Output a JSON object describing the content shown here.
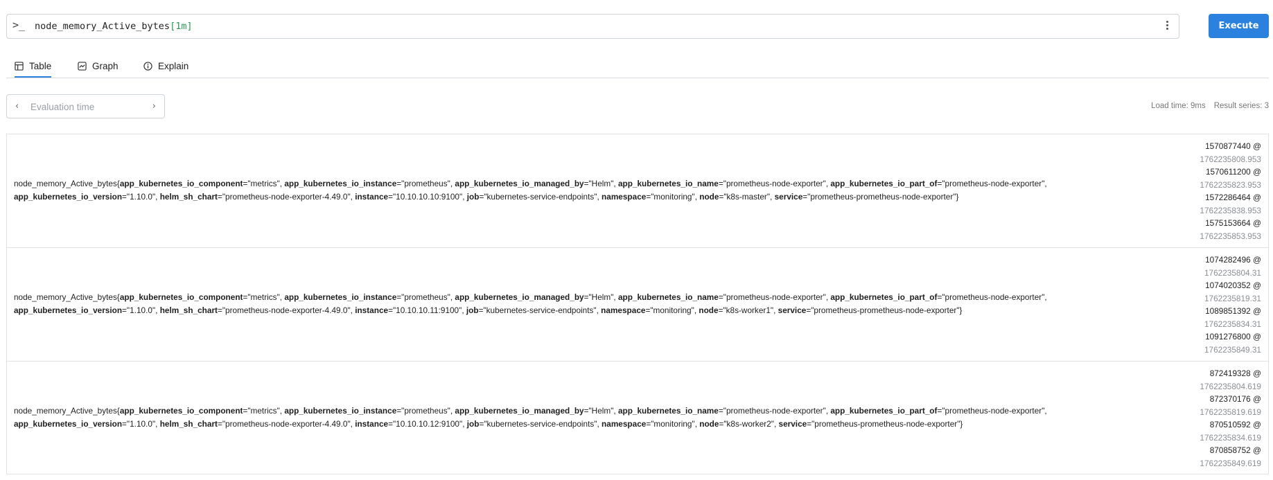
{
  "query": {
    "prompt_icon": "terminal-prompt-icon",
    "prompt_glyph": ">_",
    "expr": "node_memory_Active_bytes",
    "range": "[1m]",
    "menu_icon": "kebab-menu-icon"
  },
  "execute_label": "Execute",
  "tabs": [
    {
      "label": "Table",
      "icon": "table-icon",
      "active": true
    },
    {
      "label": "Graph",
      "icon": "graph-icon",
      "active": false
    },
    {
      "label": "Explain",
      "icon": "info-icon",
      "active": false
    }
  ],
  "eval_time": {
    "placeholder": "Evaluation time",
    "prev_glyph": "‹",
    "next_glyph": "›"
  },
  "stats": {
    "load_time": "Load time: 9ms",
    "result_series": "Result series: 3"
  },
  "results": [
    {
      "metric": "node_memory_Active_bytes",
      "labels": [
        {
          "k": "app_kubernetes_io_component",
          "v": "metrics"
        },
        {
          "k": "app_kubernetes_io_instance",
          "v": "prometheus"
        },
        {
          "k": "app_kubernetes_io_managed_by",
          "v": "Helm"
        },
        {
          "k": "app_kubernetes_io_name",
          "v": "prometheus-node-exporter"
        },
        {
          "k": "app_kubernetes_io_part_of",
          "v": "prometheus-node-exporter"
        },
        {
          "k": "app_kubernetes_io_version",
          "v": "1.10.0"
        },
        {
          "k": "helm_sh_chart",
          "v": "prometheus-node-exporter-4.49.0"
        },
        {
          "k": "instance",
          "v": "10.10.10.10:9100"
        },
        {
          "k": "job",
          "v": "kubernetes-service-endpoints"
        },
        {
          "k": "namespace",
          "v": "monitoring"
        },
        {
          "k": "node",
          "v": "k8s-master"
        },
        {
          "k": "service",
          "v": "prometheus-prometheus-node-exporter"
        }
      ],
      "samples": [
        {
          "value": "1570877440 @",
          "ts": "1762235808.953"
        },
        {
          "value": "1570611200 @",
          "ts": "1762235823.953"
        },
        {
          "value": "1572286464 @",
          "ts": "1762235838.953"
        },
        {
          "value": "1575153664 @",
          "ts": "1762235853.953"
        }
      ]
    },
    {
      "metric": "node_memory_Active_bytes",
      "labels": [
        {
          "k": "app_kubernetes_io_component",
          "v": "metrics"
        },
        {
          "k": "app_kubernetes_io_instance",
          "v": "prometheus"
        },
        {
          "k": "app_kubernetes_io_managed_by",
          "v": "Helm"
        },
        {
          "k": "app_kubernetes_io_name",
          "v": "prometheus-node-exporter"
        },
        {
          "k": "app_kubernetes_io_part_of",
          "v": "prometheus-node-exporter"
        },
        {
          "k": "app_kubernetes_io_version",
          "v": "1.10.0"
        },
        {
          "k": "helm_sh_chart",
          "v": "prometheus-node-exporter-4.49.0"
        },
        {
          "k": "instance",
          "v": "10.10.10.11:9100"
        },
        {
          "k": "job",
          "v": "kubernetes-service-endpoints"
        },
        {
          "k": "namespace",
          "v": "monitoring"
        },
        {
          "k": "node",
          "v": "k8s-worker1"
        },
        {
          "k": "service",
          "v": "prometheus-prometheus-node-exporter"
        }
      ],
      "samples": [
        {
          "value": "1074282496 @",
          "ts": "1762235804.31"
        },
        {
          "value": "1074020352 @",
          "ts": "1762235819.31"
        },
        {
          "value": "1089851392 @",
          "ts": "1762235834.31"
        },
        {
          "value": "1091276800 @",
          "ts": "1762235849.31"
        }
      ]
    },
    {
      "metric": "node_memory_Active_bytes",
      "labels": [
        {
          "k": "app_kubernetes_io_component",
          "v": "metrics"
        },
        {
          "k": "app_kubernetes_io_instance",
          "v": "prometheus"
        },
        {
          "k": "app_kubernetes_io_managed_by",
          "v": "Helm"
        },
        {
          "k": "app_kubernetes_io_name",
          "v": "prometheus-node-exporter"
        },
        {
          "k": "app_kubernetes_io_part_of",
          "v": "prometheus-node-exporter"
        },
        {
          "k": "app_kubernetes_io_version",
          "v": "1.10.0"
        },
        {
          "k": "helm_sh_chart",
          "v": "prometheus-node-exporter-4.49.0"
        },
        {
          "k": "instance",
          "v": "10.10.10.12:9100"
        },
        {
          "k": "job",
          "v": "kubernetes-service-endpoints"
        },
        {
          "k": "namespace",
          "v": "monitoring"
        },
        {
          "k": "node",
          "v": "k8s-worker2"
        },
        {
          "k": "service",
          "v": "prometheus-prometheus-node-exporter"
        }
      ],
      "samples": [
        {
          "value": "872419328 @",
          "ts": "1762235804.619"
        },
        {
          "value": "872370176 @",
          "ts": "1762235819.619"
        },
        {
          "value": "870510592 @",
          "ts": "1762235834.619"
        },
        {
          "value": "870858752 @",
          "ts": "1762235849.619"
        }
      ]
    }
  ]
}
